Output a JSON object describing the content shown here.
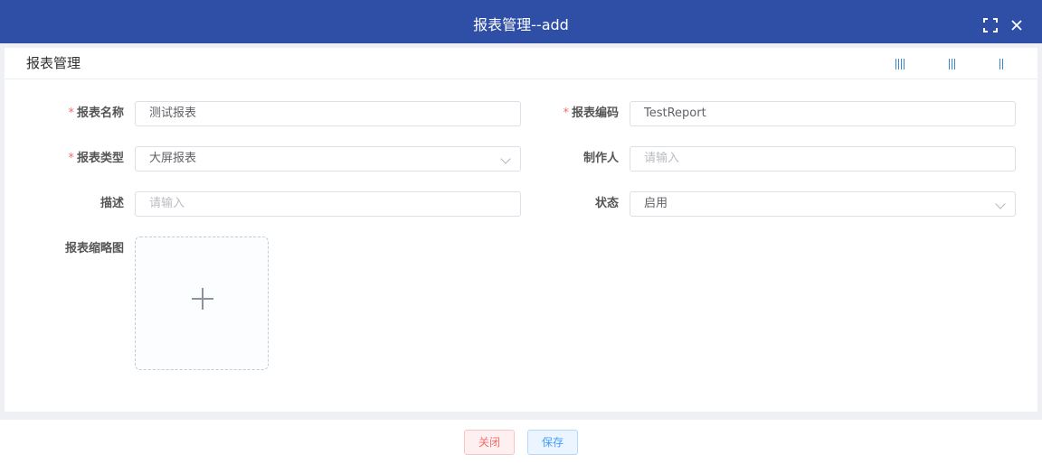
{
  "window": {
    "title": "报表管理--add",
    "fullscreen_icon": "fullscreen-icon",
    "close_icon": "close-icon"
  },
  "panel": {
    "title": "报表管理",
    "column_toggles": [
      "four-columns",
      "three-columns",
      "two-columns"
    ]
  },
  "form": {
    "report_name": {
      "label": "报表名称",
      "required": true,
      "value": "测试报表"
    },
    "report_code": {
      "label": "报表编码",
      "required": true,
      "value": "TestReport"
    },
    "report_type": {
      "label": "报表类型",
      "required": true,
      "value": "大屏报表"
    },
    "creator": {
      "label": "制作人",
      "placeholder": "请输入"
    },
    "description": {
      "label": "描述",
      "placeholder": "请输入"
    },
    "status": {
      "label": "状态",
      "value": "启用"
    },
    "thumbnail": {
      "label": "报表缩略图",
      "icon": "plus-icon"
    }
  },
  "footer": {
    "close_label": "关闭",
    "save_label": "保存"
  },
  "colors": {
    "titlebar": "#2f4fa6",
    "required": "#f56c6c",
    "primary": "#409eff"
  }
}
